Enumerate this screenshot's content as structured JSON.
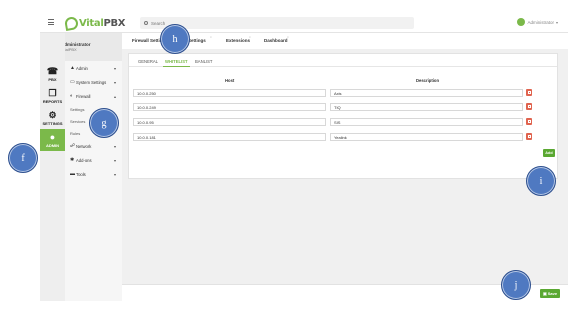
{
  "header": {
    "logo_vital": "Vital",
    "logo_pbx": "PBX",
    "search_placeholder": "Search",
    "user_name": "Administrator"
  },
  "profile": {
    "name": "Administrator",
    "subtitle": "VitalPBX"
  },
  "rail": [
    {
      "label": "PBX",
      "icon": "phone-icon"
    },
    {
      "label": "REPORTS",
      "icon": "documents-icon"
    },
    {
      "label": "SETTINGS",
      "icon": "gears-icon"
    },
    {
      "label": "ADMIN",
      "icon": "user-icon"
    }
  ],
  "submenu": {
    "admin": "Admin",
    "system_settings": "System Settings",
    "firewall": "Firewall",
    "settings": "Settings",
    "services": "Services",
    "rules": "Rules",
    "network": "Network",
    "add_ons": "Add-ons",
    "tools": "Tools"
  },
  "tabs": [
    "Firewall Settings",
    "Settings",
    "Extensions",
    "Dashboard"
  ],
  "subtabs": [
    "GENERAL",
    "WHITELIST",
    "BANLIST"
  ],
  "table": {
    "headers": {
      "host": "Host",
      "description": "Description"
    },
    "rows": [
      {
        "host": "10.0.0.250",
        "description": "Axis"
      },
      {
        "host": "10.0.0.249",
        "description": "TIQ"
      },
      {
        "host": "10.0.0.95",
        "description": "SIS"
      },
      {
        "host": "10.0.0.181",
        "description": "Yealink"
      }
    ]
  },
  "add_label": "Add",
  "save_label": "Save",
  "callouts": {
    "f": "f",
    "g": "g",
    "h": "h",
    "i": "i",
    "j": "j"
  },
  "colors": {
    "accent": "#7bb94a",
    "delete": "#e0644f",
    "callout": "#4f79c1"
  }
}
